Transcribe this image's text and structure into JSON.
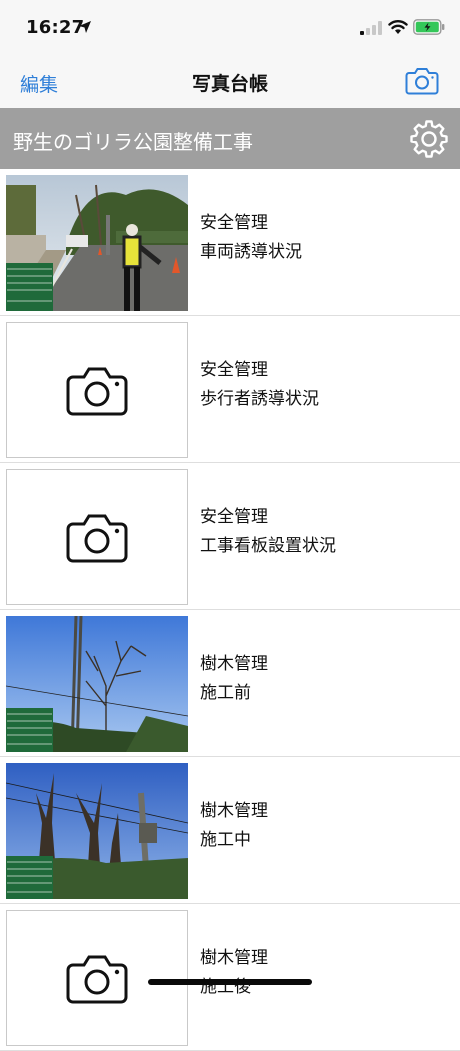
{
  "status": {
    "time": "16:27"
  },
  "nav": {
    "edit_label": "編集",
    "title": "写真台帳"
  },
  "project": {
    "title": "野生のゴリラ公園整備工事"
  },
  "rows": [
    {
      "category": "安全管理",
      "item": "車両誘導状況",
      "has_photo": true
    },
    {
      "category": "安全管理",
      "item": "歩行者誘導状況",
      "has_photo": false
    },
    {
      "category": "安全管理",
      "item": "工事看板設置状況",
      "has_photo": false
    },
    {
      "category": "樹木管理",
      "item": "施工前",
      "has_photo": true
    },
    {
      "category": "樹木管理",
      "item": "施工中",
      "has_photo": true
    },
    {
      "category": "樹木管理",
      "item": "施工後",
      "has_photo": false
    }
  ],
  "colors": {
    "accent": "#2f7fd8",
    "project_bar": "#9f9f9f",
    "battery": "#34c759",
    "board_green": "#1f6a3a"
  }
}
